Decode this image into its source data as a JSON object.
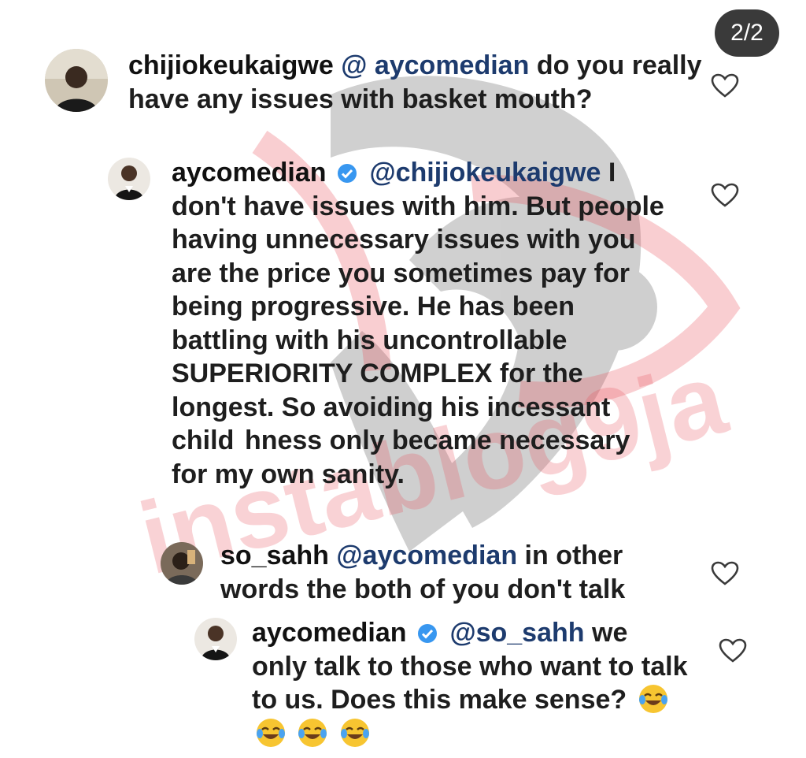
{
  "pager": {
    "label": "2/2"
  },
  "comments": [
    {
      "username": "chijiokeukaigwe",
      "mention": "@ aycomedian",
      "text": "do you really have any issues with basket mouth?"
    },
    {
      "username": "aycomedian",
      "mention": "@chijiokeukaigwe",
      "text": "I don't have issues  with  him. But people having unnecessary issues with you are the price you sometimes pay for being progressive. He has been battling with his uncontrollable SUPERIORITY COMPLEX for the longest. So avoiding his incessant child  hness only became necessary for my own sanity."
    },
    {
      "username": "so_sahh",
      "mention": "@aycomedian",
      "text": "in other words the both of you don't talk"
    },
    {
      "username": "aycomedian",
      "mention": "@so_sahh",
      "text": "we only talk to those who want to talk to us. Does this make sense?"
    }
  ],
  "watermark": {
    "text": "instablog9ja"
  },
  "icons": {
    "verified": "verified-badge-icon",
    "like": "heart-outline-icon",
    "emoji": "face-with-tears-of-joy-icon"
  },
  "colors": {
    "mention": "#1d3b6e",
    "verified": "#3897f0",
    "watermark": "#e8505b",
    "badge_bg": "#3a3a3a"
  }
}
